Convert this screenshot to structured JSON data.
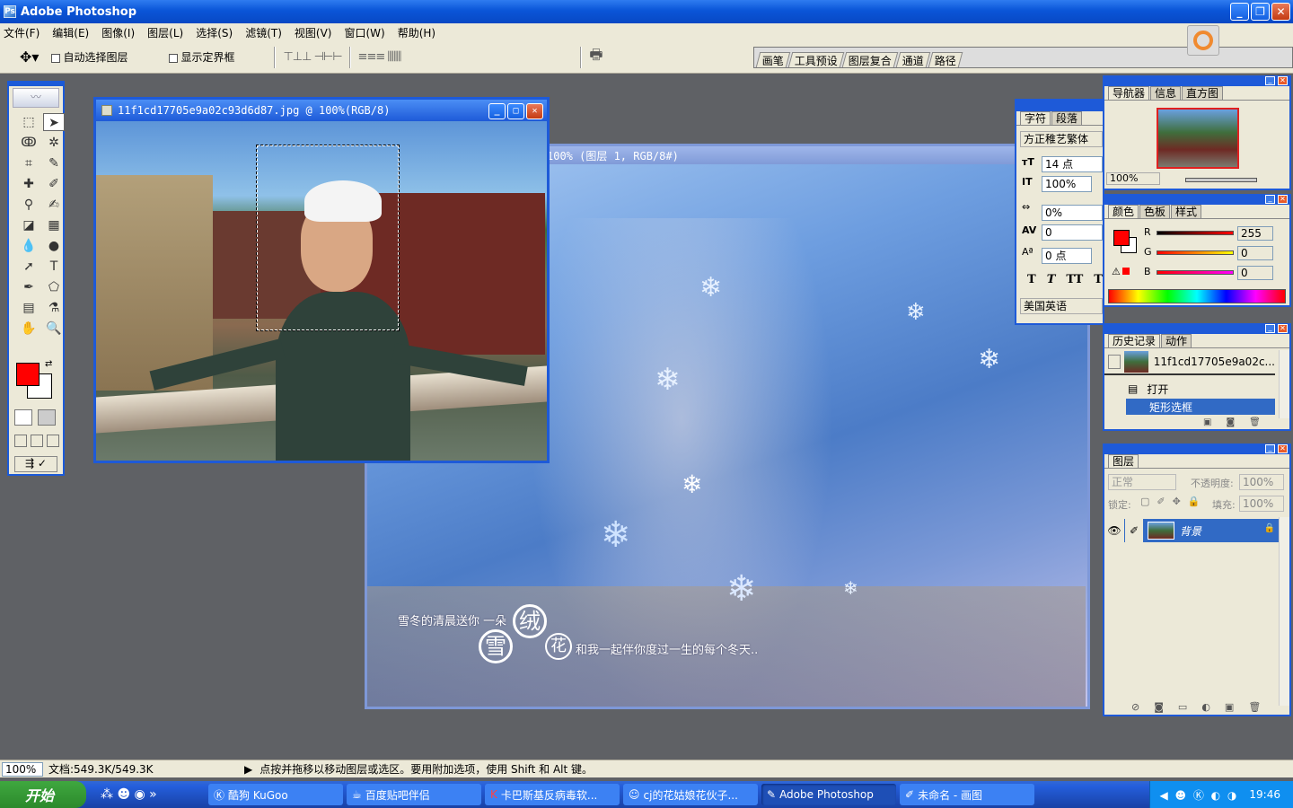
{
  "app": {
    "title": "Adobe Photoshop"
  },
  "menu": [
    "文件(F)",
    "编辑(E)",
    "图像(I)",
    "图层(L)",
    "选择(S)",
    "滤镜(T)",
    "视图(V)",
    "窗口(W)",
    "帮助(H)"
  ],
  "options": {
    "auto_select_label": "自动选择图层",
    "show_bounds_label": "显示定界框"
  },
  "palette_well": [
    "画笔",
    "工具预设",
    "图层复合",
    "通道",
    "路径"
  ],
  "doc1": {
    "title": "11f1cd17705e9a02c93d6d87.jpg @ 100%(RGB/8)"
  },
  "doc2": {
    "title": "100% (图层 1, RGB/8#)",
    "text_line1": "雪冬的清晨送你  一朵",
    "seal_chars": [
      "雪",
      "绒",
      "花"
    ],
    "text_line2": "和我一起伴你度过一生的每个冬天.."
  },
  "navigator": {
    "tabs": [
      "导航器",
      "信息",
      "直方图"
    ],
    "zoom": "100%"
  },
  "character": {
    "tabs": [
      "字符",
      "段落"
    ],
    "font": "方正稚艺繁体",
    "size": "14 点",
    "leading": "100%",
    "tracking": "0%",
    "kerning": "0",
    "baseline": "0 点",
    "styles": [
      "T",
      "T",
      "TT",
      "T"
    ],
    "language": "美国英语"
  },
  "color": {
    "tabs": [
      "颜色",
      "色板",
      "样式"
    ],
    "r_label": "R",
    "g_label": "G",
    "b_label": "B",
    "r": "255",
    "g": "0",
    "b": "0",
    "fg": "#ff0000"
  },
  "history": {
    "tabs": [
      "历史记录",
      "动作"
    ],
    "snapshot": "11f1cd17705e9a02c...",
    "items": [
      "打开",
      "矩形选框"
    ]
  },
  "layers": {
    "tab": "图层",
    "mode": "正常",
    "opacity_label": "不透明度:",
    "opacity": "100%",
    "lock_label": "锁定:",
    "fill_label": "填充:",
    "fill": "100%",
    "layer_name": "背景"
  },
  "status": {
    "zoom": "100%",
    "doc": "文档:549.3K/549.3K",
    "hint": "点按并拖移以移动图层或选区。要用附加选项，使用 Shift 和 Alt 键。"
  },
  "taskbar": {
    "start": "开始",
    "tasks": [
      "酷狗 KuGoo",
      "百度贴吧伴侣",
      "卡巴斯基反病毒软...",
      "cj的花姑娘花伙子...",
      "Adobe Photoshop",
      "未命名 - 画图"
    ],
    "clock": "19:46"
  }
}
